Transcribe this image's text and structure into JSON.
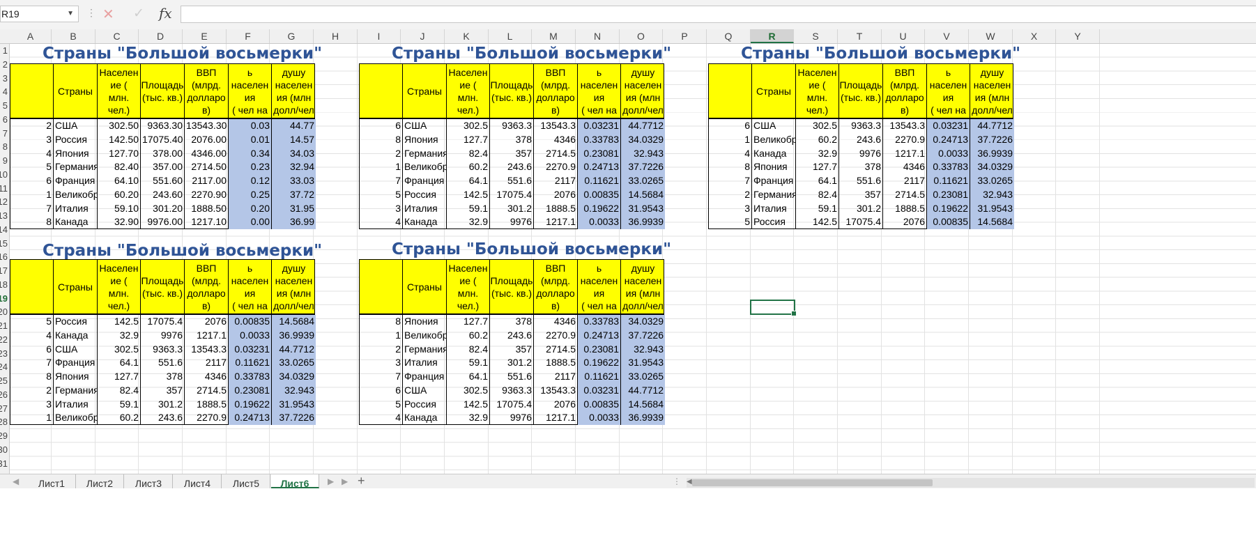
{
  "formula_bar": {
    "name_box": "R19",
    "cancel_icon": "✕",
    "enter_icon": "✓",
    "fx_label": "fx",
    "formula": ""
  },
  "columns": [
    "A",
    "B",
    "C",
    "D",
    "E",
    "F",
    "G",
    "H",
    "I",
    "J",
    "K",
    "L",
    "M",
    "N",
    "O",
    "P",
    "Q",
    "R",
    "S",
    "T",
    "U",
    "V",
    "W",
    "X",
    "Y"
  ],
  "selected_column": "R",
  "rows": [
    "1",
    "2",
    "3",
    "4",
    "5",
    "6",
    "7",
    "8",
    "9",
    "10",
    "11",
    "12",
    "13",
    "14",
    "15",
    "16",
    "17",
    "18",
    "19",
    "20",
    "21",
    "22",
    "23",
    "24",
    "25",
    "26",
    "27",
    "28",
    "29",
    "30",
    "31"
  ],
  "selected_row": "19",
  "table_header": {
    "title": "Страны \"Большой восьмерки\"",
    "country": "Страны",
    "population": [
      "Населен",
      "ие (",
      "млн.",
      "чел.)"
    ],
    "area": [
      "Площадь",
      "(тыс. кв.)"
    ],
    "gdp": [
      "ВВП",
      "(млрд.",
      "долларо",
      "в)"
    ],
    "density": [
      "ь",
      "населен",
      "ия",
      "( чел на"
    ],
    "per_capita": [
      "душу",
      "населен",
      "ия (млн",
      "долл/чел"
    ]
  },
  "tables": [
    {
      "id": "t1",
      "rows": [
        [
          "2",
          "США",
          "302.50",
          "9363.30",
          "13543.30",
          "0.03",
          "44.77"
        ],
        [
          "3",
          "Россия",
          "142.50",
          "17075.40",
          "2076.00",
          "0.01",
          "14.57"
        ],
        [
          "4",
          "Япония",
          "127.70",
          "378.00",
          "4346.00",
          "0.34",
          "34.03"
        ],
        [
          "5",
          "Германия",
          "82.40",
          "357.00",
          "2714.50",
          "0.23",
          "32.94"
        ],
        [
          "6",
          "Франция",
          "64.10",
          "551.60",
          "2117.00",
          "0.12",
          "33.03"
        ],
        [
          "1",
          "Великобр",
          "60.20",
          "243.60",
          "2270.90",
          "0.25",
          "37.72"
        ],
        [
          "7",
          "Италия",
          "59.10",
          "301.20",
          "1888.50",
          "0.20",
          "31.95"
        ],
        [
          "8",
          "Канада",
          "32.90",
          "9976.00",
          "1217.10",
          "0.00",
          "36.99"
        ]
      ]
    },
    {
      "id": "t2",
      "rows": [
        [
          "6",
          "США",
          "302.5",
          "9363.3",
          "13543.3",
          "0.03231",
          "44.7712"
        ],
        [
          "8",
          "Япония",
          "127.7",
          "378",
          "4346",
          "0.33783",
          "34.0329"
        ],
        [
          "2",
          "Германия",
          "82.4",
          "357",
          "2714.5",
          "0.23081",
          "32.943"
        ],
        [
          "1",
          "Великобр",
          "60.2",
          "243.6",
          "2270.9",
          "0.24713",
          "37.7226"
        ],
        [
          "7",
          "Франция",
          "64.1",
          "551.6",
          "2117",
          "0.11621",
          "33.0265"
        ],
        [
          "5",
          "Россия",
          "142.5",
          "17075.4",
          "2076",
          "0.00835",
          "14.5684"
        ],
        [
          "3",
          "Италия",
          "59.1",
          "301.2",
          "1888.5",
          "0.19622",
          "31.9543"
        ],
        [
          "4",
          "Канада",
          "32.9",
          "9976",
          "1217.1",
          "0.0033",
          "36.9939"
        ]
      ]
    },
    {
      "id": "t3",
      "rows": [
        [
          "6",
          "США",
          "302.5",
          "9363.3",
          "13543.3",
          "0.03231",
          "44.7712"
        ],
        [
          "1",
          "Великобр",
          "60.2",
          "243.6",
          "2270.9",
          "0.24713",
          "37.7226"
        ],
        [
          "4",
          "Канада",
          "32.9",
          "9976",
          "1217.1",
          "0.0033",
          "36.9939"
        ],
        [
          "8",
          "Япония",
          "127.7",
          "378",
          "4346",
          "0.33783",
          "34.0329"
        ],
        [
          "7",
          "Франция",
          "64.1",
          "551.6",
          "2117",
          "0.11621",
          "33.0265"
        ],
        [
          "2",
          "Германия",
          "82.4",
          "357",
          "2714.5",
          "0.23081",
          "32.943"
        ],
        [
          "3",
          "Италия",
          "59.1",
          "301.2",
          "1888.5",
          "0.19622",
          "31.9543"
        ],
        [
          "5",
          "Россия",
          "142.5",
          "17075.4",
          "2076",
          "0.00835",
          "14.5684"
        ]
      ]
    },
    {
      "id": "t4",
      "rows": [
        [
          "5",
          "Россия",
          "142.5",
          "17075.4",
          "2076",
          "0.00835",
          "14.5684"
        ],
        [
          "4",
          "Канада",
          "32.9",
          "9976",
          "1217.1",
          "0.0033",
          "36.9939"
        ],
        [
          "6",
          "США",
          "302.5",
          "9363.3",
          "13543.3",
          "0.03231",
          "44.7712"
        ],
        [
          "7",
          "Франция",
          "64.1",
          "551.6",
          "2117",
          "0.11621",
          "33.0265"
        ],
        [
          "8",
          "Япония",
          "127.7",
          "378",
          "4346",
          "0.33783",
          "34.0329"
        ],
        [
          "2",
          "Германия",
          "82.4",
          "357",
          "2714.5",
          "0.23081",
          "32.943"
        ],
        [
          "3",
          "Италия",
          "59.1",
          "301.2",
          "1888.5",
          "0.19622",
          "31.9543"
        ],
        [
          "1",
          "Великобр",
          "60.2",
          "243.6",
          "2270.9",
          "0.24713",
          "37.7226"
        ]
      ]
    },
    {
      "id": "t5",
      "rows": [
        [
          "8",
          "Япония",
          "127.7",
          "378",
          "4346",
          "0.33783",
          "34.0329"
        ],
        [
          "1",
          "Великобр",
          "60.2",
          "243.6",
          "2270.9",
          "0.24713",
          "37.7226"
        ],
        [
          "2",
          "Германия",
          "82.4",
          "357",
          "2714.5",
          "0.23081",
          "32.943"
        ],
        [
          "3",
          "Италия",
          "59.1",
          "301.2",
          "1888.5",
          "0.19622",
          "31.9543"
        ],
        [
          "7",
          "Франция",
          "64.1",
          "551.6",
          "2117",
          "0.11621",
          "33.0265"
        ],
        [
          "6",
          "США",
          "302.5",
          "9363.3",
          "13543.3",
          "0.03231",
          "44.7712"
        ],
        [
          "5",
          "Россия",
          "142.5",
          "17075.4",
          "2076",
          "0.00835",
          "14.5684"
        ],
        [
          "4",
          "Канада",
          "32.9",
          "9976",
          "1217.1",
          "0.0033",
          "36.9939"
        ]
      ]
    }
  ],
  "sheet_tabs": [
    "Лист1",
    "Лист2",
    "Лист3",
    "Лист4",
    "Лист5",
    "Лист6"
  ],
  "active_tab": "Лист6",
  "add_sheet_icon": "+",
  "colors": {
    "header_fill": "#ffff00",
    "highlight_fill": "#b4c6e7",
    "title_color": "#2f5496",
    "accent": "#217346"
  }
}
